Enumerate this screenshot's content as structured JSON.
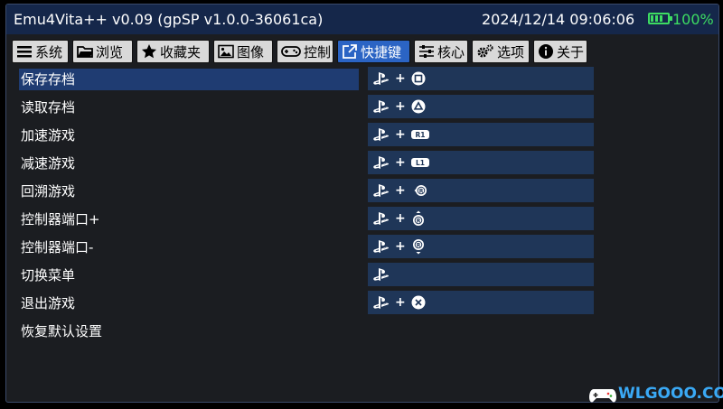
{
  "header": {
    "title": "Emu4Vita++ v0.09 (gpSP v1.0.0-36061ca)",
    "datetime": "2024/12/14 09:06:06",
    "battery": "100%"
  },
  "tabs": [
    {
      "label": "系统",
      "icon": "menu-icon"
    },
    {
      "label": "浏览",
      "icon": "folder-icon"
    },
    {
      "label": "收藏夹",
      "icon": "star-icon"
    },
    {
      "label": "图像",
      "icon": "image-icon"
    },
    {
      "label": "控制",
      "icon": "gamepad-icon"
    },
    {
      "label": "快捷键",
      "icon": "external-link-icon",
      "active": true
    },
    {
      "label": "核心",
      "icon": "sliders-icon"
    },
    {
      "label": "选项",
      "icon": "gears-icon"
    },
    {
      "label": "关于",
      "icon": "info-icon"
    }
  ],
  "hotkeys": [
    {
      "label": "保存存档",
      "combo": [
        "ps-button",
        "square-button"
      ],
      "selected": true
    },
    {
      "label": "读取存档",
      "combo": [
        "ps-button",
        "triangle-button"
      ]
    },
    {
      "label": "加速游戏",
      "combo": [
        "ps-button",
        "r1-button"
      ]
    },
    {
      "label": "减速游戏",
      "combo": [
        "ps-button",
        "l1-button"
      ]
    },
    {
      "label": "回溯游戏",
      "combo": [
        "ps-button",
        "right-stick-left"
      ]
    },
    {
      "label": "控制器端口+",
      "combo": [
        "ps-button",
        "right-stick-up"
      ]
    },
    {
      "label": "控制器端口-",
      "combo": [
        "ps-button",
        "right-stick-down"
      ]
    },
    {
      "label": "切换菜单",
      "combo": [
        "ps-button"
      ]
    },
    {
      "label": "退出游戏",
      "combo": [
        "ps-button",
        "cross-button"
      ]
    },
    {
      "label": "恢复默认设置",
      "combo": []
    }
  ],
  "labels": {
    "plus": "+",
    "r1": "R1",
    "l1": "L1",
    "stick": "R"
  },
  "watermark": "WLGOOO.COM",
  "colors": {
    "titlebar": "#15274a",
    "tab_active": "#2b64c4",
    "row_selected": "#1f3c72",
    "key_box": "#1f3658",
    "battery": "#3ddc62"
  }
}
